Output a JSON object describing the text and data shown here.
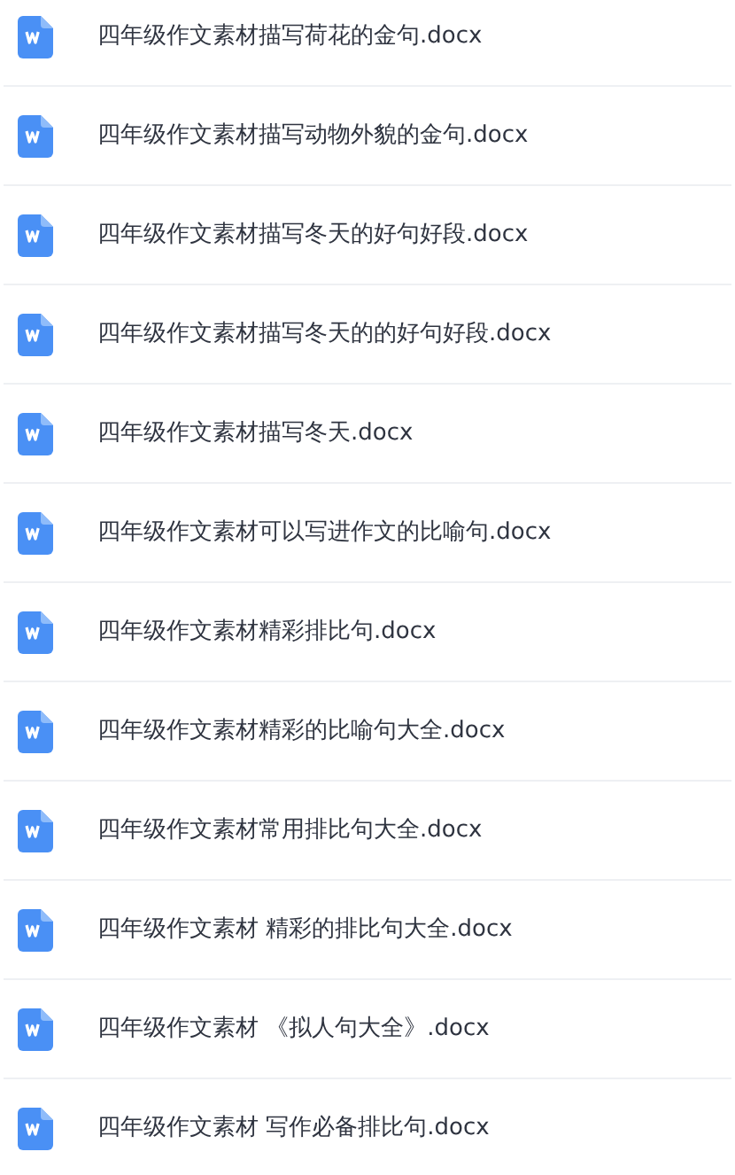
{
  "files": [
    {
      "name": "四年级作文素材描写荷花的金句.docx"
    },
    {
      "name": "四年级作文素材描写动物外貌的金句.docx"
    },
    {
      "name": "四年级作文素材描写冬天的好句好段.docx"
    },
    {
      "name": "四年级作文素材描写冬天的的好句好段.docx"
    },
    {
      "name": "四年级作文素材描写冬天.docx"
    },
    {
      "name": "四年级作文素材可以写进作文的比喻句.docx"
    },
    {
      "name": "四年级作文素材精彩排比句.docx"
    },
    {
      "name": "四年级作文素材精彩的比喻句大全.docx"
    },
    {
      "name": "四年级作文素材常用排比句大全.docx"
    },
    {
      "name": "四年级作文素材 精彩的排比句大全.docx"
    },
    {
      "name": "四年级作文素材 《拟人句大全》.docx"
    },
    {
      "name": "四年级作文素材 写作必备排比句.docx"
    }
  ]
}
